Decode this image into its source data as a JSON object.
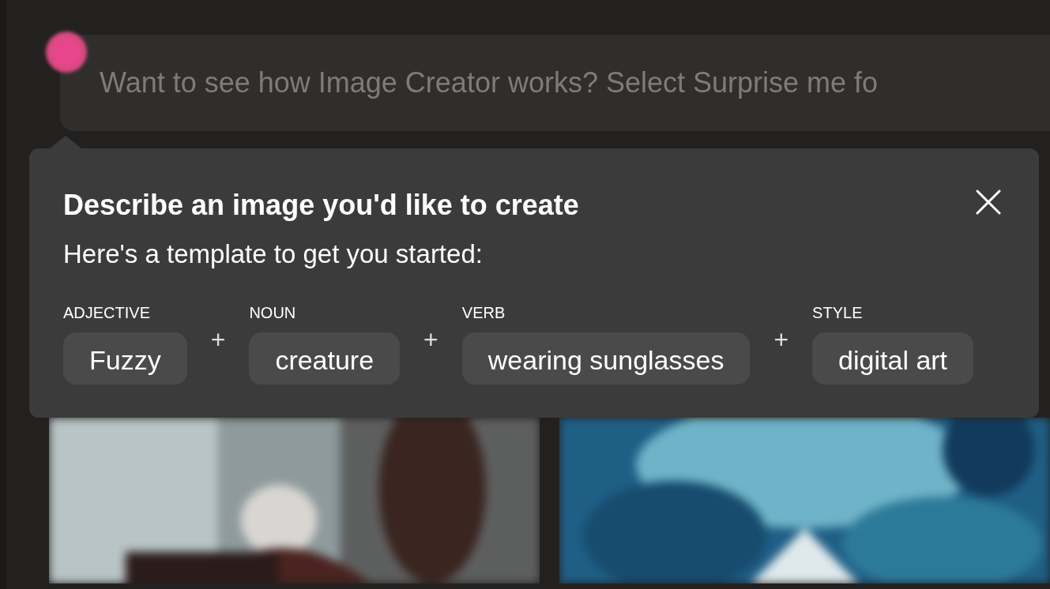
{
  "search": {
    "text": "Want to see how Image Creator works? Select Surprise me fo"
  },
  "popover": {
    "title": "Describe an image you'd like to create",
    "subtitle": "Here's a template to get you started:",
    "parts": [
      {
        "kind": "slot",
        "label": "ADJECTIVE",
        "value": "Fuzzy"
      },
      {
        "kind": "plus",
        "text": "+"
      },
      {
        "kind": "slot",
        "label": "NOUN",
        "value": "creature"
      },
      {
        "kind": "plus",
        "text": "+"
      },
      {
        "kind": "slot",
        "label": "VERB",
        "value": "wearing sunglasses"
      },
      {
        "kind": "plus",
        "text": "+"
      },
      {
        "kind": "slot",
        "label": "STYLE",
        "value": "digital art"
      }
    ]
  }
}
